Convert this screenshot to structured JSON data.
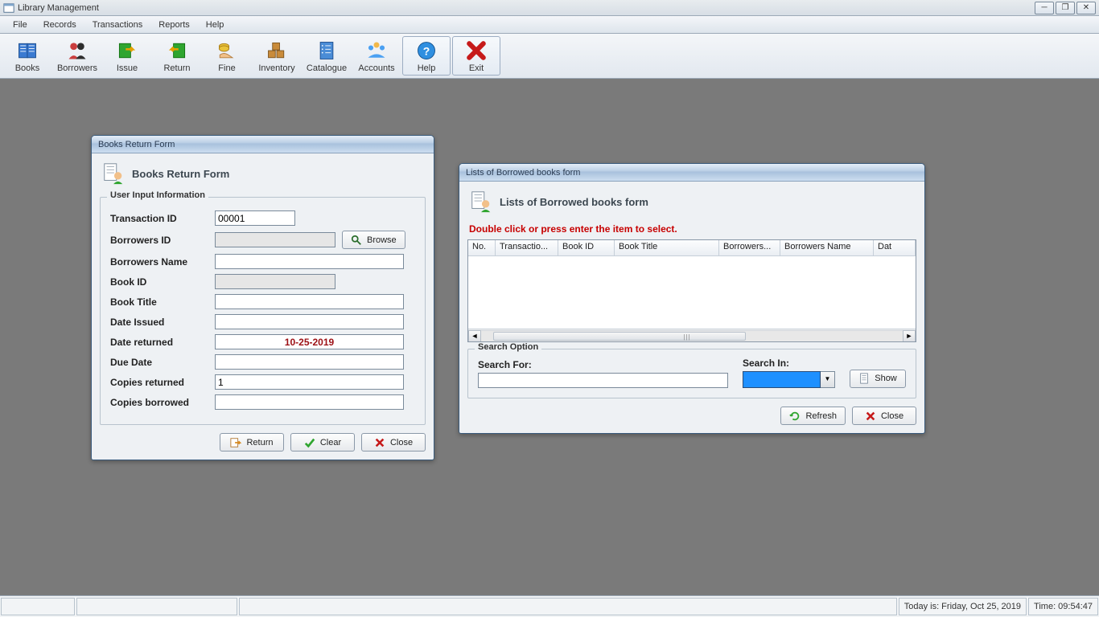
{
  "app": {
    "title": "Library Management"
  },
  "menu": {
    "items": [
      "File",
      "Records",
      "Transactions",
      "Reports",
      "Help"
    ]
  },
  "toolbar": {
    "items": [
      {
        "key": "books",
        "label": "Books"
      },
      {
        "key": "borrowers",
        "label": "Borrowers"
      },
      {
        "key": "issue",
        "label": "Issue"
      },
      {
        "key": "return",
        "label": "Return"
      },
      {
        "key": "fine",
        "label": "Fine"
      },
      {
        "key": "inventory",
        "label": "Inventory"
      },
      {
        "key": "catalogue",
        "label": "Catalogue"
      },
      {
        "key": "accounts",
        "label": "Accounts"
      },
      {
        "key": "help",
        "label": "Help"
      },
      {
        "key": "exit",
        "label": "Exit"
      }
    ]
  },
  "return_form": {
    "window_title": "Books Return Form",
    "header_title": "Books Return Form",
    "group_legend": "User Input Information",
    "labels": {
      "transaction_id": "Transaction ID",
      "borrowers_id": "Borrowers ID",
      "borrowers_name": "Borrowers Name",
      "book_id": "Book ID",
      "book_title": "Book Title",
      "date_issued": "Date Issued",
      "date_returned": "Date returned",
      "due_date": "Due Date",
      "copies_returned": "Copies returned",
      "copies_borrowed": "Copies borrowed"
    },
    "values": {
      "transaction_id": "00001",
      "borrowers_id": "",
      "borrowers_name": "",
      "book_id": "",
      "book_title": "",
      "date_issued": "",
      "date_returned": "10-25-2019",
      "due_date": "",
      "copies_returned": "1",
      "copies_borrowed": ""
    },
    "buttons": {
      "browse": "Browse",
      "return": "Return",
      "clear": "Clear",
      "close": "Close"
    }
  },
  "list_form": {
    "window_title": "Lists of Borrowed books form",
    "header_title": "Lists of Borrowed books form",
    "hint": "Double click or press enter the item to select.",
    "columns": [
      "No.",
      "Transactio...",
      "Book ID",
      "Book Title",
      "Borrowers...",
      "Borrowers Name",
      "Dat"
    ],
    "search_group_legend": "Search Option",
    "search_for_label": "Search For:",
    "search_in_label": "Search In:",
    "buttons": {
      "show": "Show",
      "refresh": "Refresh",
      "close": "Close"
    }
  },
  "statusbar": {
    "today_label": "Today is: Friday, Oct 25, 2019",
    "time_label": "Time: 09:54:47"
  }
}
